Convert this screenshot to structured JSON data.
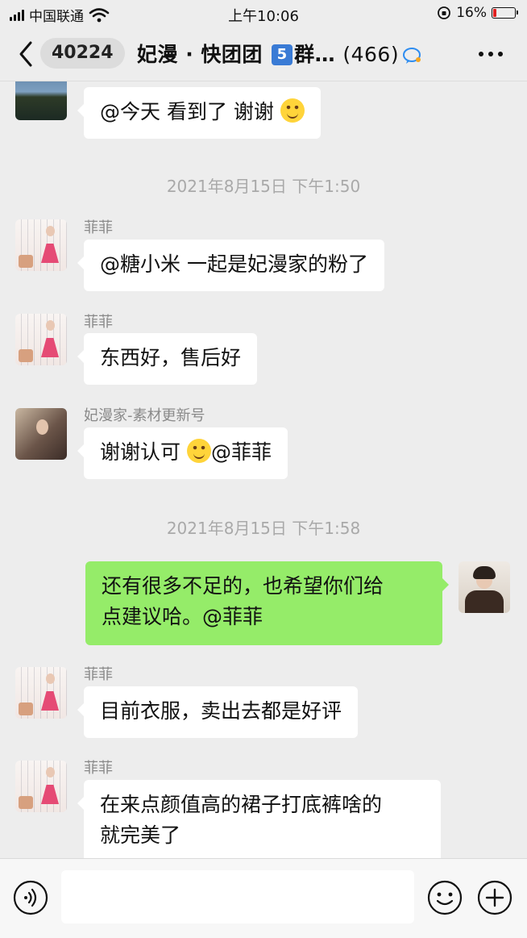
{
  "status_bar": {
    "carrier": "中国联通",
    "time": "上午10:06",
    "battery": "16%",
    "battery_level": 0.16
  },
  "header": {
    "back_count": "40224",
    "title_prefix": "妃漫 · 快团团 ",
    "title_badge": "5",
    "title_suffix": "群…",
    "member_count": "(466)"
  },
  "messages": {
    "m0": {
      "text": "@今天 看到了 谢谢"
    },
    "ts1": "2021年8月15日 下午1:50",
    "m1": {
      "sender": "菲菲",
      "text": "@糖小米 一起是妃漫家的粉了"
    },
    "m2": {
      "sender": "菲菲",
      "text": "东西好，售后好"
    },
    "m3": {
      "sender": "妃漫家-素材更新号",
      "text_a": "谢谢认可 ",
      "text_b": "@菲菲"
    },
    "ts2": "2021年8月15日 下午1:58",
    "m4": {
      "line1": "还有很多不足的，也希望你们给",
      "line2": "点建议哈。@菲菲"
    },
    "m5": {
      "sender": "菲菲",
      "text": "目前衣服，卖出去都是好评"
    },
    "m6": {
      "sender": "菲菲",
      "line1": "在来点颜值高的裙子打底裤啥的",
      "line2": "就完美了"
    }
  },
  "icons": {
    "voice": "voice-icon",
    "emoji": "smile-icon",
    "plus": "plus-icon",
    "more": "more-icon",
    "back": "chevron-left-icon"
  },
  "colors": {
    "background": "#ededed",
    "self_bubble": "#95ec69",
    "other_bubble": "#ffffff",
    "timestamp": "#a9a9a9"
  }
}
